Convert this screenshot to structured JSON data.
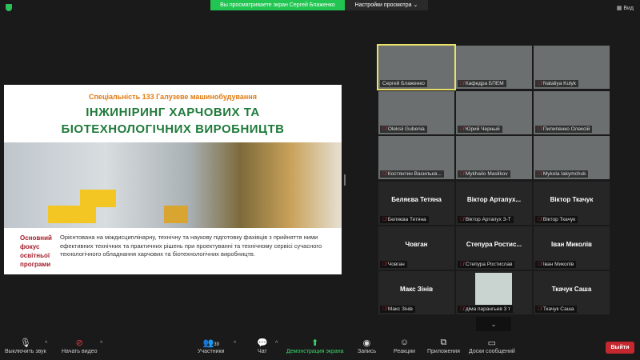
{
  "topbar": {
    "viewing": "Вы просматриваете экран Сергей Блаженко",
    "view_options": "Настройки просмотра ⌄",
    "view": "Вид"
  },
  "slide": {
    "subtitle": "Спеціальність 133 Галузеве машинобудування",
    "heading1": "ІНЖИНІРИНГ ХАРЧОВИХ ТА",
    "heading2": "БІОТЕХНОЛОГІЧНИХ ВИРОБНИЦТВ",
    "focus": [
      "Основний",
      "фокус",
      "освітньої",
      "програми"
    ],
    "description": "Орієнтована на міждисциплінарну, технічну та наукову підготовку фахівців з прийняття ними ефективних технічних та практичних рішень при проектуванні та технічному сервісі сучасного технологічного обладнання харчових та біотехнологічних виробництв."
  },
  "participants": [
    {
      "name": "Сергей Блаженко",
      "video": true,
      "active": true
    },
    {
      "name": "Кафедра БПЕМ",
      "video": true
    },
    {
      "name": "Nataliya Kulyk",
      "video": true
    },
    {
      "name": "Oleksii Gubenia",
      "video": true
    },
    {
      "name": "Юрий Черный",
      "video": true
    },
    {
      "name": "Пилипенко Олексій",
      "video": true
    },
    {
      "name": "Костянтин Васильєв...",
      "video": true
    },
    {
      "name": "Mykhailo Maslikov",
      "video": true
    },
    {
      "name": "Mykola Iakymchuk",
      "video": true
    },
    {
      "big": "Беляєва Тетяна",
      "name": "Беляєва Тетяна"
    },
    {
      "big": "Віктор Артапух...",
      "name": "Віктор Артапух З-Т"
    },
    {
      "big": "Віктор Ткачук",
      "name": "Віктор Ткачук"
    },
    {
      "big": "Човган",
      "name": "Човган"
    },
    {
      "big": "Степура Ростис...",
      "name": "Степура Ростислав"
    },
    {
      "big": "Іван Миколів",
      "name": "Іван Миколів"
    },
    {
      "big": "Макс Зінів",
      "name": "Макс Зінів"
    },
    {
      "thumb": true,
      "name": "діма парангьев 3 т"
    },
    {
      "big": "Ткачук Саша",
      "name": "Ткачук Саша"
    }
  ],
  "toolbar": {
    "mute": "Выключить звук",
    "video": "Начать видео",
    "participants": "Участники",
    "participants_count": "39",
    "chat": "Чат",
    "share": "Демонстрация экрана",
    "record": "Запись",
    "reactions": "Реакции",
    "apps": "Приложения",
    "whiteboards": "Доски сообщений",
    "leave": "Выйти"
  }
}
